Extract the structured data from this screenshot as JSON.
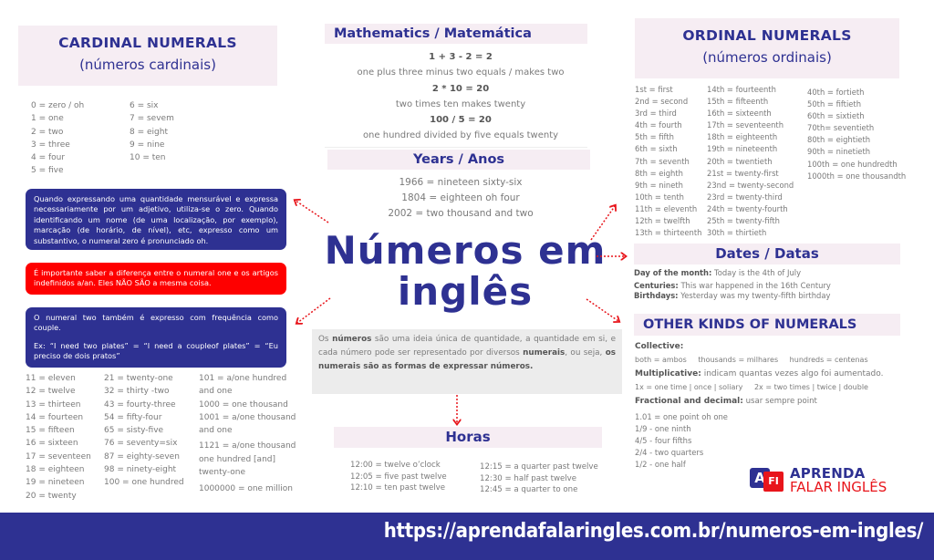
{
  "cardinal": {
    "title": "CARDINAL NUMERALS",
    "subtitle": "(números cardinais)",
    "col_a": [
      "0 = zero / oh",
      "1 = one",
      "2 = two",
      "3 = three",
      "4 = four",
      "5 = five"
    ],
    "col_b": [
      "6 = six",
      "7 = sevem",
      "8 = eight",
      "9 = nine",
      "10 = ten"
    ],
    "col_c": [
      "11 = eleven",
      "12 = twelve",
      "13 = thirteen",
      "14 = fourteen",
      "15 = fifteen",
      "16 = sixteen",
      "17 = seventeen",
      "18 = eighteen",
      "19 = nineteen",
      "20 = twenty"
    ],
    "col_d": [
      "21 = twenty-one",
      "32 = thirty -two",
      "43 = fourty-three",
      "54 = fifty-four",
      "65 = sisty-five",
      "76 = seventy=six",
      "87 = eighty-seven",
      "98 = ninety-eight",
      "100 = one hundred"
    ],
    "col_e": [
      "101 = a/one hundred and one",
      "1000 = one thousand",
      "1001 = a/one thousand and one",
      "1121 = a/one thousand one hundred [and] twenty-one",
      "1000000 = one million"
    ]
  },
  "notes": {
    "zero": "Quando expressando uma quantidade mensurável e expressa necessariamente por um adjetivo, utiliza-se o zero. Quando identificando um nome (de uma localização, por exemplo), marcação (de horário, de nível), etc, expresso como um substantivo, o numeral zero é pronunciado oh.",
    "one": "É importante saber a diferença entre o numeral one e os artigos indefinidos a/an. Eles NÃO SÃO a mesma coisa.",
    "two_p1": "O numeral two também é expresso com frequência como couple.",
    "two_p2": "Ex: “I need two plates” = “I need a coupleof plates” = “Eu preciso de dois pratos”"
  },
  "math": {
    "title": "Mathematics / Matemática",
    "items": [
      {
        "eq": "1 + 3 - 2 = 2",
        "text": "one plus three minus two equals / makes two"
      },
      {
        "eq": "2 * 10 = 20",
        "text": "two times ten makes twenty"
      },
      {
        "eq": "100 / 5 = 20",
        "text": "one hundred divided by five equals twenty"
      }
    ]
  },
  "years": {
    "title": "Years / Anos",
    "items": [
      "1966 = nineteen sixty-six",
      "1804 = eighteen oh four",
      "2002 = two thousand and two"
    ]
  },
  "main": {
    "title_line1": "Números em",
    "title_line2": "inglês"
  },
  "definition": {
    "p1": "Os ",
    "b1": "números",
    "p2": " são uma ideia única de quantidade, a quantidade em si, e cada número pode ser representado por diversos ",
    "b2": "numerais",
    "p3": ", ou seja, ",
    "b3": "os numerais são as formas de expressar números."
  },
  "horas": {
    "title": "Horas",
    "col_a": [
      "12:00 = twelve o’clock",
      "12:05 = five past twelve",
      "12:10 = ten past twelve"
    ],
    "col_b": [
      "12:15 = a quarter past twelve",
      "12:30 = half past twelve",
      "12:45 = a quarter to one"
    ]
  },
  "ordinal": {
    "title": "ORDINAL NUMERALS",
    "subtitle": "(números ordinais)",
    "col_a": [
      "1st = first",
      "2nd = second",
      "3rd = third",
      "4th = fourth",
      "5th = fifth",
      "6th = sixth",
      "7th = seventh",
      "8th = eighth",
      "9th = nineth",
      "10th = tenth",
      "11th = eleventh",
      "12th = twelfth",
      "13th = thirteenth"
    ],
    "col_b": [
      "14th = fourteenth",
      "15th = fifteenth",
      "16th = sixteenth",
      "17th = seventeenth",
      "18th = eighteenth",
      "19th = nineteenth",
      "20th = twentieth",
      "21st = twenty-first",
      "23nd = twenty-second",
      "23rd = twenty-third",
      "24th = twenty-fourth",
      "25th = twenty-fifth",
      "30th = thirtieth"
    ],
    "col_c": [
      "40th = fortieth",
      "50th = fiftieth",
      "60th = sixtieth",
      "70th= seventieth",
      "80th = eightieth",
      "90th = ninetieth",
      "100th = one hundredth",
      "1000th = one thousandth"
    ]
  },
  "dates": {
    "title": "Dates / Datas",
    "items": [
      {
        "label": "Day of the month:",
        "text": " Today is the 4th of July"
      },
      {
        "label": "Centuries:",
        "text": " This war happened in the 16th Century"
      },
      {
        "label": "Birthdays:",
        "text": " Yesterday was my twenty-fifth birthday"
      }
    ]
  },
  "other": {
    "title": "OTHER KINDS OF NUMERALS",
    "collective_label": "Collective:",
    "collective_items": [
      "both = ambos",
      "thousands = milhares",
      "hundreds = centenas"
    ],
    "multiplicative_label": "Multiplicative:",
    "multiplicative_text": "  indicam quantas vezes algo foi aumentado.",
    "multiplicative_items": [
      "1x = one time | once | soliary",
      "2x = two times | twice | double"
    ],
    "fractional_label": "Fractional and decimal:",
    "fractional_text": " usar sempre point",
    "fractional_items": [
      "1.01 = one point oh one",
      "1/9 - one ninth",
      "4/5 - four fifths",
      "2/4 - two quarters",
      "1/2 - one half"
    ]
  },
  "logo": {
    "icon_a": "A",
    "icon_fi": "FI",
    "line1": "APRENDA",
    "line2": "FALAR INGLÊS"
  },
  "footer": {
    "url": "https://aprendafalaringles.com.br/numeros-em-ingles/"
  },
  "colors": {
    "navy": "#2e3192",
    "red": "#fe0000",
    "header_bg": "#f6edf3",
    "definition_bg": "#ececec"
  }
}
